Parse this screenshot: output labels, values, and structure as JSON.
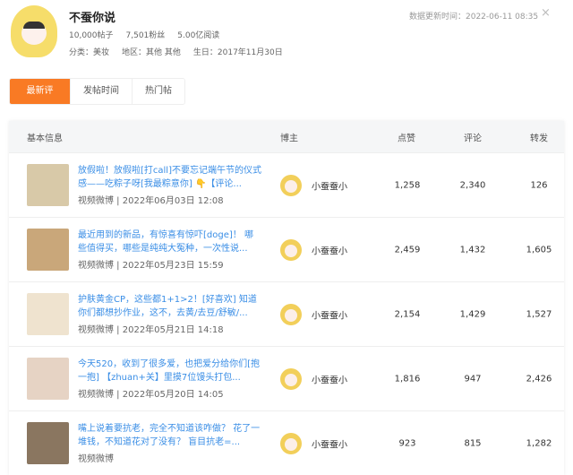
{
  "profile": {
    "name": "不蚕你说",
    "posts": "10,000帖子",
    "fans": "7,501粉丝",
    "reads": "5.00亿阅读",
    "category": "分类：美妆",
    "region": "地区：其他 其他",
    "birthday": "生日：2017年11月30日",
    "update_time": "数据更新时间：2022-06-11 08:35",
    "close": "×"
  },
  "tabs": [
    {
      "label": "最新评论帖",
      "active": true
    },
    {
      "label": "发帖时间"
    },
    {
      "label": "热门帖"
    }
  ],
  "table": {
    "headers": {
      "info": "基本信息",
      "blogger": "博主",
      "likes": "点赞",
      "comments": "评论",
      "reposts": "转发"
    },
    "rows": [
      {
        "title": "放假啦！放假啦[打call]不要忘记端午节的仪式感——吃粽子呀[我最粽意你] 👇【评论...",
        "sub": "视频微博 | 2022年06月03日 12:08",
        "blogger": "小蚕蚕小",
        "likes": "1,258",
        "comments": "2,340",
        "reposts": "126",
        "thumb": "#d8c9a8"
      },
      {
        "title": "最近用到的新品，有惊喜有惊吓[doge]！ 哪些值得买，哪些是纯纯大冤种，一次性说...",
        "sub": "视频微博 | 2022年05月23日 15:59",
        "blogger": "小蚕蚕小",
        "likes": "2,459",
        "comments": "1,432",
        "reposts": "1,605",
        "thumb": "#c9a77a"
      },
      {
        "title": "护肤黄金CP，这些都1+1>2！[好喜欢] 知道你们都想抄作业，这不，去黄/去豆/舒敏/...",
        "sub": "视频微博 | 2022年05月21日 14:18",
        "blogger": "小蚕蚕小",
        "likes": "2,154",
        "comments": "1,429",
        "reposts": "1,527",
        "thumb": "#efe3cf"
      },
      {
        "title": "今天520，收到了很多爱，也把爱分给你们[抱一抱] 【zhuan+关】里摸7位馒头打包...",
        "sub": "视频微博 | 2022年05月20日 14:05",
        "blogger": "小蚕蚕小",
        "likes": "1,816",
        "comments": "947",
        "reposts": "2,426",
        "thumb": "#e6d3c4"
      },
      {
        "title": "嘴上说着要抗老，完全不知道该咋做？ 花了一堆钱，不知道花对了没有？ 盲目抗老=...",
        "sub": "视频微博",
        "blogger": "小蚕蚕小",
        "likes": "923",
        "comments": "815",
        "reposts": "1,282",
        "thumb": "#8a7660"
      }
    ]
  }
}
